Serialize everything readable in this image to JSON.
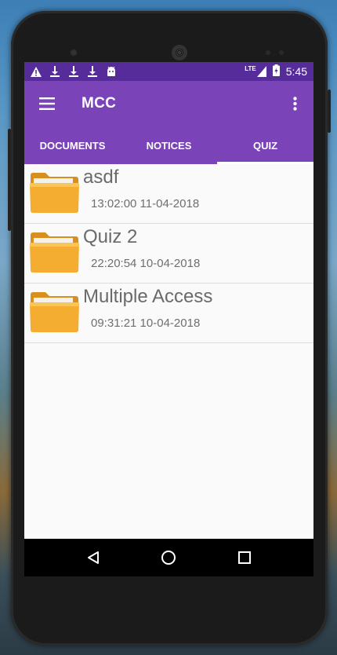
{
  "status_bar": {
    "time": "5:45",
    "network": "LTE",
    "icons": [
      "warning-icon",
      "download-icon",
      "download-icon",
      "download-icon",
      "android-icon"
    ]
  },
  "toolbar": {
    "title": "MCC",
    "menu_icon": "hamburger-menu-icon",
    "more_icon": "more-vert-icon"
  },
  "tabs": [
    {
      "label": "DOCUMENTS",
      "active": false
    },
    {
      "label": "NOTICES",
      "active": false
    },
    {
      "label": "QUIZ",
      "active": true
    }
  ],
  "items": [
    {
      "name": "asdf",
      "timestamp": "13:02:00 11-04-2018"
    },
    {
      "name": "Quiz 2",
      "timestamp": "22:20:54 10-04-2018"
    },
    {
      "name": "Multiple Access",
      "timestamp": "09:31:21 10-04-2018"
    }
  ],
  "nav": [
    "back-icon",
    "home-icon",
    "recents-icon"
  ],
  "colors": {
    "primary": "#7b43b8",
    "primary_dark": "#552c9a",
    "folder": "#f2a92b"
  }
}
